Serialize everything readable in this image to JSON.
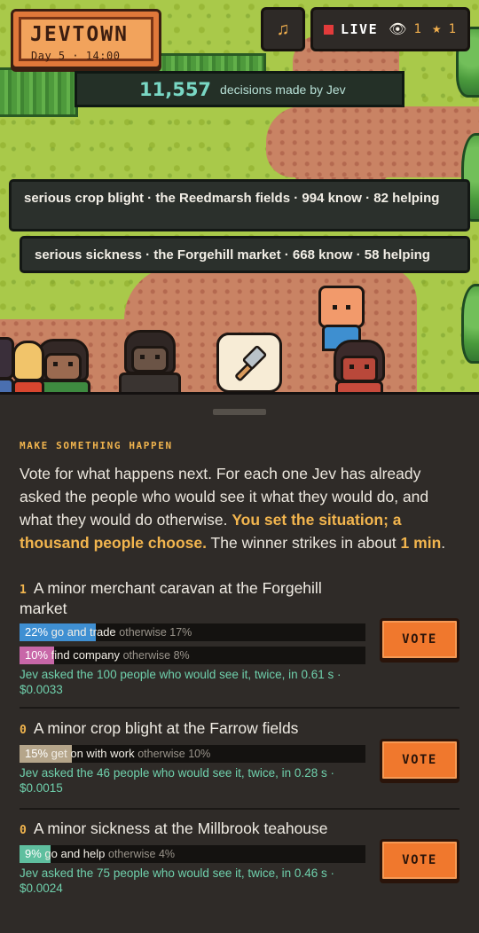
{
  "header": {
    "logo_title": "JEVTOWN",
    "day_time": "Day 5 · 14:00",
    "music_icon": "♫",
    "live_label": "LIVE",
    "viewers": "1",
    "stars": "1"
  },
  "decisions": {
    "count": "11,557",
    "label": "decisions made by Jev"
  },
  "events": [
    "serious crop blight · the Reedmarsh fields · 994 know · 82 helping",
    "serious sickness · the Forgehill market · 668 know · 58 helping"
  ],
  "panel": {
    "title": "MAKE SOMETHING HAPPEN",
    "intro_a": "Vote for what happens next. For each one Jev has already asked the people who would see it what they would do, and what they would do otherwise. ",
    "intro_b": "You set the situation; a thousand people choose.",
    "intro_c": " The winner strikes in about ",
    "intro_d": "1 min",
    "intro_e": ".",
    "vote_label": "VOTE"
  },
  "options": [
    {
      "votes": "1",
      "title": "A minor merchant caravan at the Forgehill market",
      "bars": [
        {
          "pct": "22%",
          "action": "go and trade",
          "other": "otherwise 17%",
          "fill": 0.22,
          "color": "#3f8fd2"
        },
        {
          "pct": "10%",
          "action": "find company",
          "other": "otherwise 8%",
          "fill": 0.1,
          "color": "#c867a8"
        }
      ],
      "cost": "Jev asked the 100 people who would see it, twice, in 0.61 s · $0.0033"
    },
    {
      "votes": "0",
      "title": "A minor crop blight at the Farrow fields",
      "bars": [
        {
          "pct": "15%",
          "action": "get on with work",
          "other": "otherwise 10%",
          "fill": 0.15,
          "color": "#b5a58a"
        }
      ],
      "cost": "Jev asked the 46 people who would see it, twice, in 0.28 s · $0.0015"
    },
    {
      "votes": "0",
      "title": "A minor sickness at the Millbrook teahouse",
      "bars": [
        {
          "pct": "9%",
          "action": "go and help",
          "other": "otherwise 4%",
          "fill": 0.09,
          "color": "#5fbf9f"
        }
      ],
      "cost": "Jev asked the 75 people who would see it, twice, in 0.46 s · $0.0024"
    }
  ]
}
